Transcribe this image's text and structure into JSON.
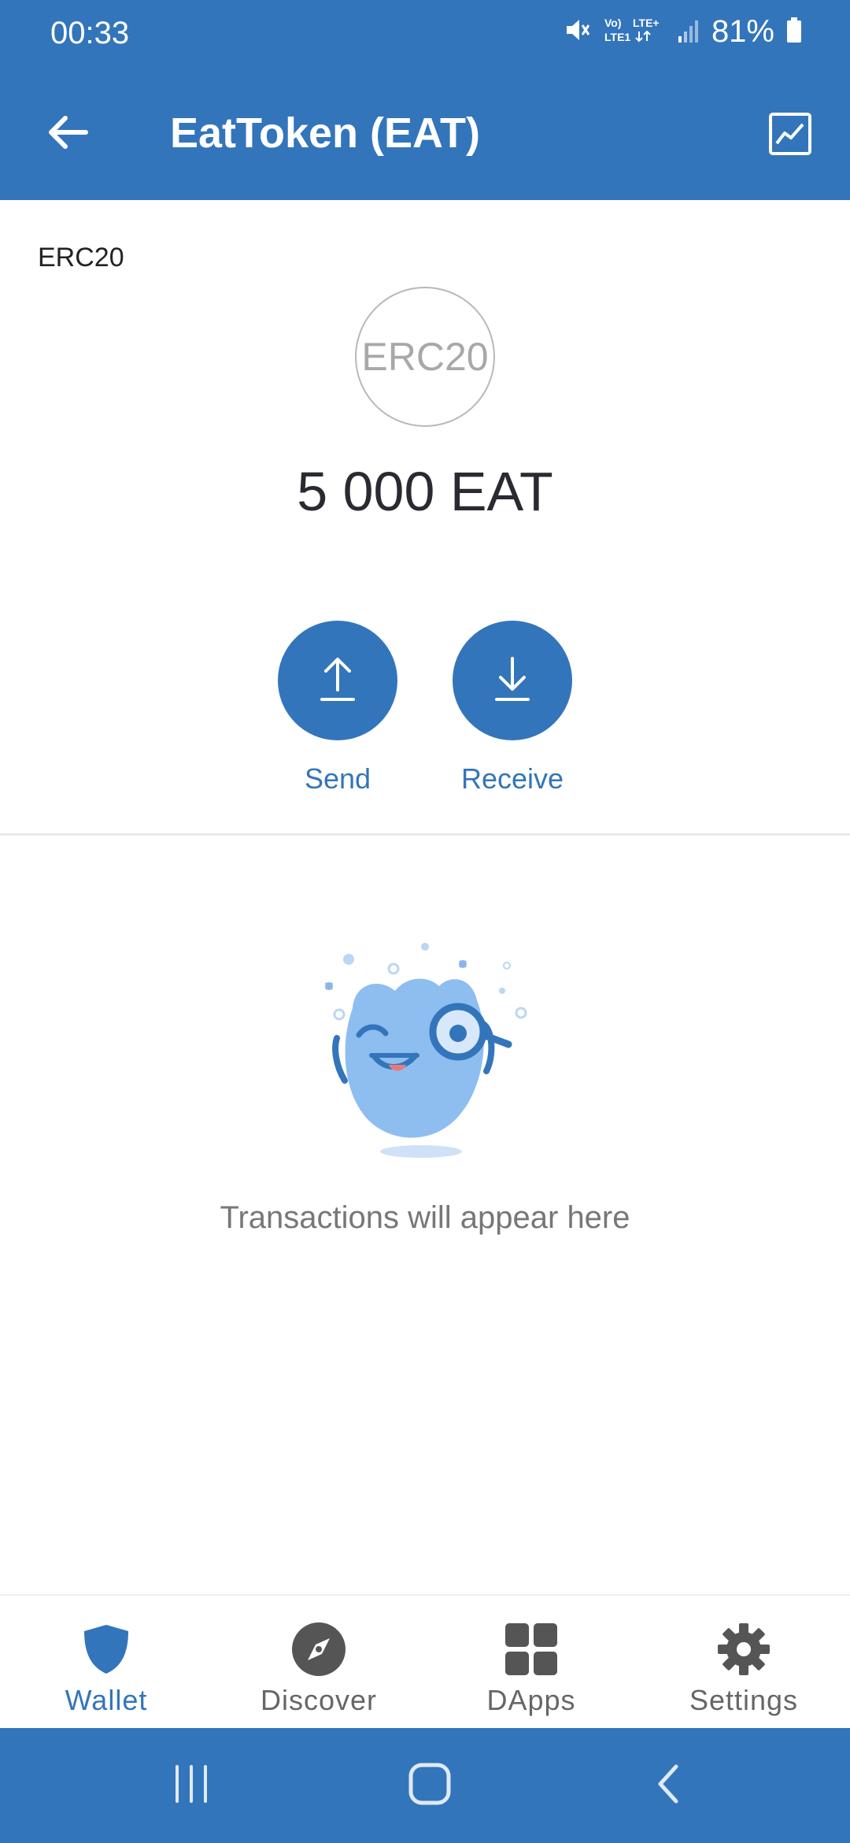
{
  "status_bar": {
    "time": "00:33",
    "network": "Vo) LTE+ LTE1",
    "battery": "81%"
  },
  "header": {
    "title": "EatToken (EAT)",
    "back_icon": "arrow-left-icon",
    "chart_icon": "price-chart-icon"
  },
  "token": {
    "standard": "ERC20",
    "logo_text": "ERC20",
    "balance": "5 000 EAT"
  },
  "actions": {
    "send_label": "Send",
    "receive_label": "Receive"
  },
  "empty_state": {
    "message": "Transactions will appear here"
  },
  "bottom_nav": {
    "items": [
      {
        "label": "Wallet",
        "icon": "shield-icon",
        "active": true
      },
      {
        "label": "Discover",
        "icon": "compass-icon",
        "active": false
      },
      {
        "label": "DApps",
        "icon": "grid-icon",
        "active": false
      },
      {
        "label": "Settings",
        "icon": "gear-icon",
        "active": false
      }
    ]
  },
  "colors": {
    "primary": "#3375BB",
    "text_dark": "#2a2a33",
    "muted": "#777777"
  }
}
